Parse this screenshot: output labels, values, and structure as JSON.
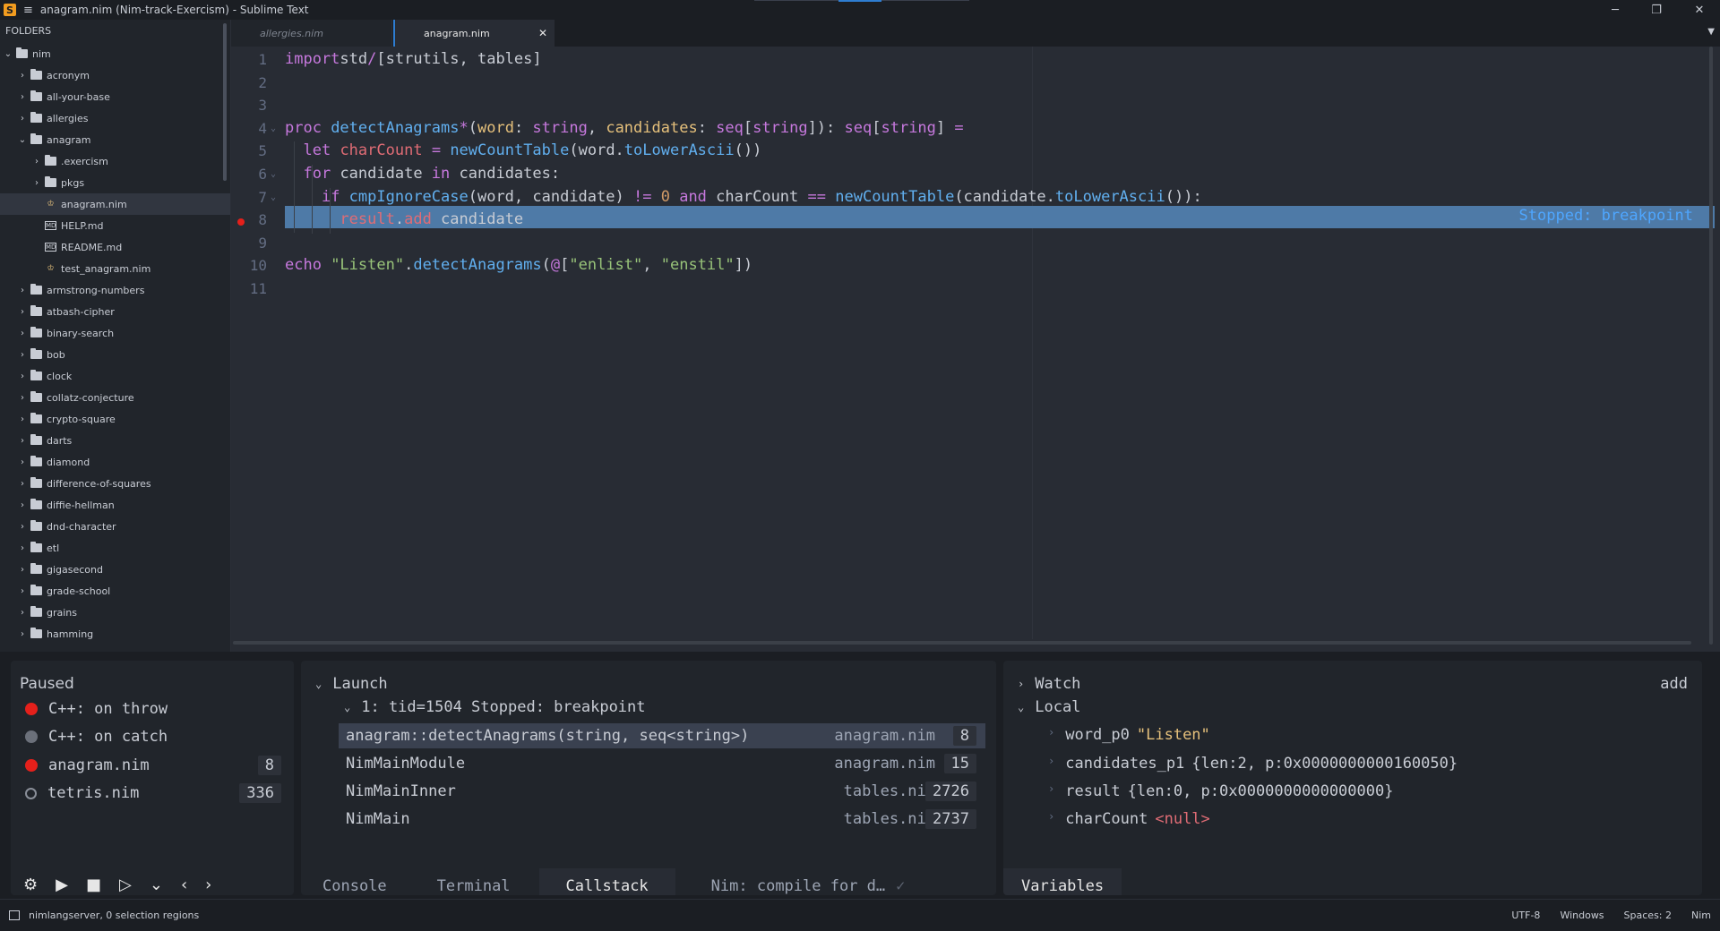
{
  "window": {
    "title": "anagram.nim (Nim-track-Exercism) - Sublime Text",
    "controls": {
      "minimize": "─",
      "restore": "❐",
      "close": "✕"
    }
  },
  "sidebar": {
    "header": "FOLDERS",
    "items": [
      {
        "label": "nim",
        "kind": "folder",
        "expanded": true,
        "depth": 0
      },
      {
        "label": "acronym",
        "kind": "folder",
        "depth": 1
      },
      {
        "label": "all-your-base",
        "kind": "folder",
        "depth": 1
      },
      {
        "label": "allergies",
        "kind": "folder",
        "depth": 1
      },
      {
        "label": "anagram",
        "kind": "folder",
        "expanded": true,
        "depth": 1
      },
      {
        "label": ".exercism",
        "kind": "folder",
        "depth": 2
      },
      {
        "label": "pkgs",
        "kind": "folder",
        "depth": 2
      },
      {
        "label": "anagram.nim",
        "kind": "nim-file",
        "depth": 2,
        "selected": true
      },
      {
        "label": "HELP.md",
        "kind": "md-file",
        "depth": 2
      },
      {
        "label": "README.md",
        "kind": "md-file",
        "depth": 2
      },
      {
        "label": "test_anagram.nim",
        "kind": "nim-file",
        "depth": 2
      },
      {
        "label": "armstrong-numbers",
        "kind": "folder",
        "depth": 1
      },
      {
        "label": "atbash-cipher",
        "kind": "folder",
        "depth": 1
      },
      {
        "label": "binary-search",
        "kind": "folder",
        "depth": 1
      },
      {
        "label": "bob",
        "kind": "folder",
        "depth": 1
      },
      {
        "label": "clock",
        "kind": "folder",
        "depth": 1
      },
      {
        "label": "collatz-conjecture",
        "kind": "folder",
        "depth": 1
      },
      {
        "label": "crypto-square",
        "kind": "folder",
        "depth": 1
      },
      {
        "label": "darts",
        "kind": "folder",
        "depth": 1
      },
      {
        "label": "diamond",
        "kind": "folder",
        "depth": 1
      },
      {
        "label": "difference-of-squares",
        "kind": "folder",
        "depth": 1
      },
      {
        "label": "diffie-hellman",
        "kind": "folder",
        "depth": 1
      },
      {
        "label": "dnd-character",
        "kind": "folder",
        "depth": 1
      },
      {
        "label": "etl",
        "kind": "folder",
        "depth": 1
      },
      {
        "label": "gigasecond",
        "kind": "folder",
        "depth": 1
      },
      {
        "label": "grade-school",
        "kind": "folder",
        "depth": 1
      },
      {
        "label": "grains",
        "kind": "folder",
        "depth": 1
      },
      {
        "label": "hamming",
        "kind": "folder",
        "depth": 1
      }
    ]
  },
  "tabs": [
    {
      "label": "allergies.nim",
      "active": false
    },
    {
      "label": "anagram.nim",
      "active": true
    }
  ],
  "editor": {
    "stopped_label": "Stopped: breakpoint",
    "breakpoint_line": 8,
    "lines": [
      {
        "n": "1",
        "tokens": [
          [
            "kw",
            "import"
          ],
          [
            "",
            "std"
          ],
          [
            "op",
            "/"
          ],
          [
            "",
            "[strutils, tables]"
          ]
        ]
      },
      {
        "n": "2",
        "tokens": []
      },
      {
        "n": "3",
        "tokens": []
      },
      {
        "n": "4",
        "fold": true,
        "tokens": [
          [
            "kw",
            "proc "
          ],
          [
            "fn",
            "detectAnagrams"
          ],
          [
            "op",
            "*"
          ],
          [
            "",
            "("
          ],
          [
            "par",
            "word"
          ],
          [
            "",
            ": "
          ],
          [
            "ty",
            "string"
          ],
          [
            "",
            ", "
          ],
          [
            "par",
            "candidates"
          ],
          [
            "",
            ": "
          ],
          [
            "ty",
            "seq"
          ],
          [
            "",
            "["
          ],
          [
            "ty",
            "string"
          ],
          [
            "",
            "]): "
          ],
          [
            "ty",
            "seq"
          ],
          [
            "",
            "["
          ],
          [
            "ty",
            "string"
          ],
          [
            "",
            "] "
          ],
          [
            "op",
            "="
          ]
        ]
      },
      {
        "n": "5",
        "tokens": [
          [
            "",
            "  "
          ],
          [
            "kw",
            "let "
          ],
          [
            "red",
            "charCount"
          ],
          [
            "",
            " "
          ],
          [
            "op",
            "="
          ],
          [
            "",
            " "
          ],
          [
            "fn",
            "newCountTable"
          ],
          [
            "",
            "(word."
          ],
          [
            "fn",
            "toLowerAscii"
          ],
          [
            "",
            "())"
          ]
        ]
      },
      {
        "n": "6",
        "fold": true,
        "tokens": [
          [
            "",
            "  "
          ],
          [
            "kw",
            "for "
          ],
          [
            "",
            "candidate "
          ],
          [
            "kw",
            "in"
          ],
          [
            "",
            " candidates:"
          ]
        ]
      },
      {
        "n": "7",
        "fold": true,
        "tokens": [
          [
            "",
            "    "
          ],
          [
            "kw",
            "if "
          ],
          [
            "fn",
            "cmpIgnoreCase"
          ],
          [
            "",
            "(word, candidate) "
          ],
          [
            "op",
            "!="
          ],
          [
            "",
            " "
          ],
          [
            "num",
            "0"
          ],
          [
            "",
            " "
          ],
          [
            "kw",
            "and"
          ],
          [
            "",
            " charCount "
          ],
          [
            "op",
            "=="
          ],
          [
            "",
            " "
          ],
          [
            "fn",
            "newCountTable"
          ],
          [
            "",
            "(candidate."
          ],
          [
            "fn",
            "toLowerAscii"
          ],
          [
            "",
            "()):"
          ]
        ]
      },
      {
        "n": "8",
        "tokens": [
          [
            "",
            "      "
          ],
          [
            "red",
            "result"
          ],
          [
            "",
            "."
          ],
          [
            "red",
            "add"
          ],
          [
            "",
            " candidate"
          ]
        ]
      },
      {
        "n": "9",
        "tokens": []
      },
      {
        "n": "10",
        "tokens": [
          [
            "kw",
            "echo "
          ],
          [
            "str",
            "\"Listen\""
          ],
          [
            "",
            "."
          ],
          [
            "fn",
            "detectAnagrams"
          ],
          [
            "",
            "("
          ],
          [
            "op",
            "@"
          ],
          [
            "",
            "["
          ],
          [
            "str",
            "\"enlist\""
          ],
          [
            "",
            ", "
          ],
          [
            "str",
            "\"enstil\""
          ],
          [
            "",
            "])"
          ]
        ]
      },
      {
        "n": "11",
        "tokens": []
      }
    ]
  },
  "debug": {
    "breakpoints": {
      "title": "Paused",
      "items": [
        {
          "label": "C++: on throw",
          "state": "red",
          "count": ""
        },
        {
          "label": "C++: on catch",
          "state": "gray",
          "count": ""
        },
        {
          "label": "anagram.nim",
          "state": "red",
          "count": "8"
        },
        {
          "label": "tetris.nim",
          "state": "hollow",
          "count": "336"
        }
      ],
      "toolbar": [
        "gear-icon",
        "play-icon",
        "stop-icon",
        "step-over-icon",
        "step-into-icon",
        "step-back-icon",
        "step-forward-icon"
      ]
    },
    "callstack": {
      "title": "Launch",
      "thread": "1: tid=1504 Stopped: breakpoint",
      "frames": [
        {
          "name": "anagram::detectAnagrams(string, seq<string>)",
          "file": "anagram.nim",
          "line": "8",
          "selected": true
        },
        {
          "name": "NimMainModule",
          "file": "anagram.nim",
          "line": "15"
        },
        {
          "name": "NimMainInner",
          "file": "tables.nim",
          "line": "2726"
        },
        {
          "name": "NimMain",
          "file": "tables.nim",
          "line": "2737"
        }
      ],
      "tabs": [
        "Console",
        "Terminal",
        "Callstack",
        "Nim: compile for d…"
      ],
      "active_tab": "Callstack"
    },
    "variables": {
      "watch": "Watch",
      "add": "add",
      "local": "Local",
      "items": [
        {
          "name": "word_p0",
          "value": "\"Listen\""
        },
        {
          "name": "candidates_p1",
          "value": "{len:2, p:0x0000000000160050}"
        },
        {
          "name": "result",
          "value": "{len:0, p:0x0000000000000000}"
        },
        {
          "name": "charCount",
          "value": "<null>"
        }
      ],
      "tab": "Variables"
    }
  },
  "statusbar": {
    "left": "nimlangserver, 0 selection regions",
    "encoding": "UTF-8",
    "line_endings": "Windows",
    "indent": "Spaces: 2",
    "syntax": "Nim"
  }
}
